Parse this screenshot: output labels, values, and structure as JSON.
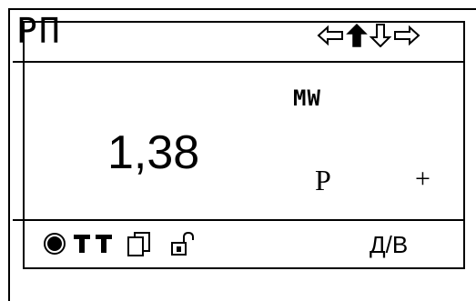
{
  "header": {
    "title": "РП",
    "nav_icons": [
      "arrow-left-outline-icon",
      "arrow-up-filled-icon",
      "arrow-down-outline-icon",
      "arrow-right-outline-icon"
    ]
  },
  "main": {
    "value": "1,38",
    "unit": "MW",
    "mode": "P",
    "sign": "+"
  },
  "footer": {
    "status_icons": [
      "circle-indicator-icon",
      "double-t-icon",
      "copy-pages-icon",
      "unlocked-padlock-icon"
    ],
    "control_mode": "Д/В"
  },
  "colors": {
    "background": "#ffffff",
    "foreground": "#000000"
  }
}
